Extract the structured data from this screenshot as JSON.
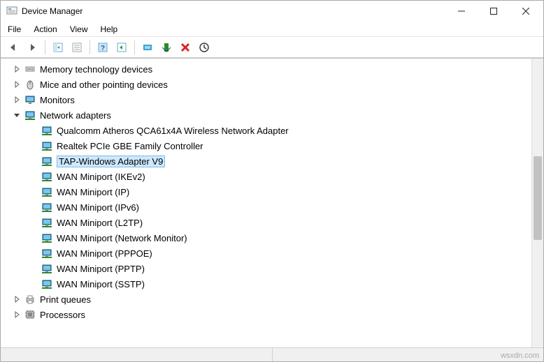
{
  "window": {
    "title": "Device Manager"
  },
  "menubar": {
    "items": [
      "File",
      "Action",
      "View",
      "Help"
    ]
  },
  "tree": {
    "nodes": [
      {
        "label": "Memory technology devices",
        "icon": "memory",
        "expanded": false,
        "selected": false
      },
      {
        "label": "Mice and other pointing devices",
        "icon": "mouse",
        "expanded": false,
        "selected": false
      },
      {
        "label": "Monitors",
        "icon": "monitor",
        "expanded": false,
        "selected": false
      },
      {
        "label": "Network adapters",
        "icon": "network",
        "expanded": true,
        "selected": false,
        "children": [
          {
            "label": "Qualcomm Atheros QCA61x4A Wireless Network Adapter",
            "icon": "network",
            "selected": false
          },
          {
            "label": "Realtek PCIe GBE Family Controller",
            "icon": "network",
            "selected": false
          },
          {
            "label": "TAP-Windows Adapter V9",
            "icon": "network",
            "selected": true
          },
          {
            "label": "WAN Miniport (IKEv2)",
            "icon": "network",
            "selected": false
          },
          {
            "label": "WAN Miniport (IP)",
            "icon": "network",
            "selected": false
          },
          {
            "label": "WAN Miniport (IPv6)",
            "icon": "network",
            "selected": false
          },
          {
            "label": "WAN Miniport (L2TP)",
            "icon": "network",
            "selected": false
          },
          {
            "label": "WAN Miniport (Network Monitor)",
            "icon": "network",
            "selected": false
          },
          {
            "label": "WAN Miniport (PPPOE)",
            "icon": "network",
            "selected": false
          },
          {
            "label": "WAN Miniport (PPTP)",
            "icon": "network",
            "selected": false
          },
          {
            "label": "WAN Miniport (SSTP)",
            "icon": "network",
            "selected": false
          }
        ]
      },
      {
        "label": "Print queues",
        "icon": "printer",
        "expanded": false,
        "selected": false
      },
      {
        "label": "Processors",
        "icon": "cpu",
        "expanded": false,
        "selected": false
      }
    ]
  },
  "watermark": "wsxdn.com"
}
